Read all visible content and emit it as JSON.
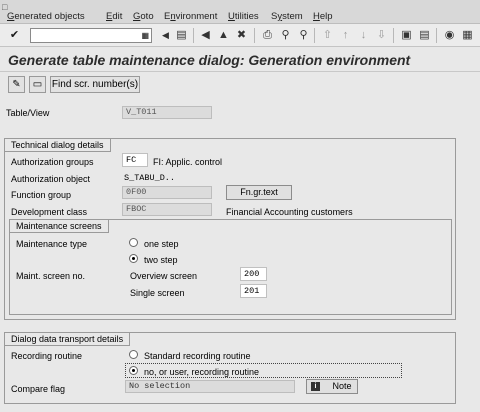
{
  "menu": {
    "items": [
      "Generated objects",
      "Edit",
      "Goto",
      "Environment",
      "Utilities",
      "System",
      "Help"
    ],
    "underline": [
      "G",
      "E",
      "G",
      "n",
      "U",
      "y",
      "H"
    ]
  },
  "toolbar": {
    "command_field_value": "",
    "icons": [
      "enter-icon",
      "back-icon",
      "exit-icon",
      "cancel-icon",
      "print-icon",
      "find-icon",
      "find-next-icon",
      "first-page-icon",
      "prev-page-icon",
      "next-page-icon",
      "last-page-icon",
      "new-session-icon",
      "shortcut-icon",
      "help-icon",
      "layout-icon"
    ]
  },
  "title": "Generate table maintenance dialog: Generation environment",
  "app_toolbar": {
    "find_button": "Find scr. number(s)"
  },
  "table_view": {
    "label": "Table/View",
    "value": "V_T011"
  },
  "technical": {
    "title": "Technical dialog details",
    "auth_groups_label": "Authorization groups",
    "auth_groups_value": "FC",
    "auth_groups_text": "FI: Applic. control",
    "auth_object_label": "Authorization object",
    "auth_object_value": "S_TABU_D..",
    "function_group_label": "Function group",
    "function_group_value": "0F00",
    "fn_button": "Fn.gr.text",
    "dev_class_label": "Development class",
    "dev_class_value": "FBOC",
    "dev_class_text": "Financial Accounting customers"
  },
  "maintenance": {
    "title": "Maintenance screens",
    "type_label": "Maintenance type",
    "one_step": "one step",
    "two_step": "two step",
    "selected": "two step",
    "screen_no_label": "Maint. screen no.",
    "overview_label": "Overview screen",
    "overview_value": "200",
    "single_label": "Single screen",
    "single_value": "201"
  },
  "transport": {
    "title": "Dialog data transport details",
    "recording_label": "Recording routine",
    "standard_option": "Standard recording routine",
    "user_option": "no, or user, recording routine",
    "selected": "no, or user, recording routine",
    "compare_label": "Compare flag",
    "compare_value": "No selection",
    "note_button": "Note"
  }
}
